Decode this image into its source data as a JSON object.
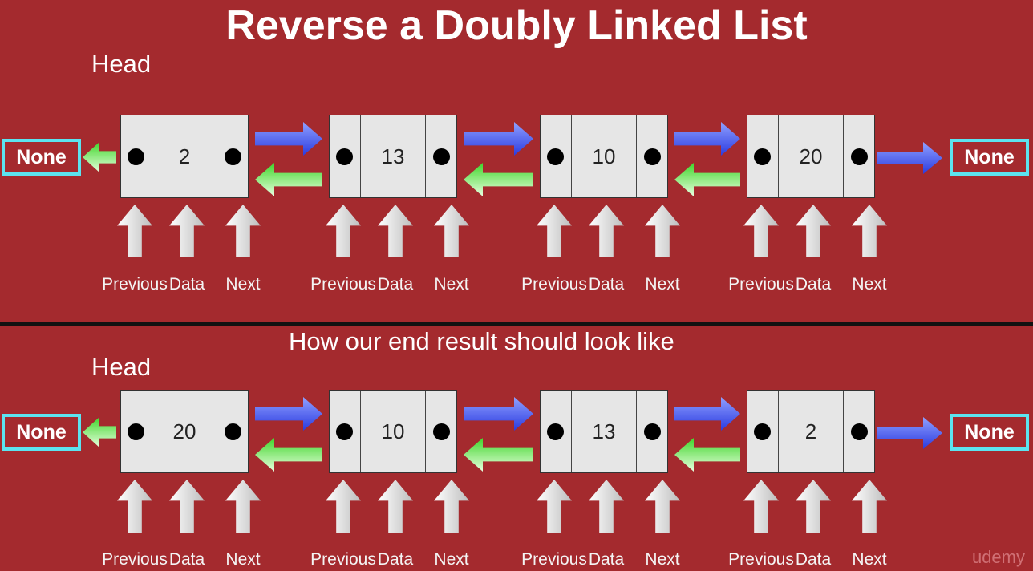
{
  "title": "Reverse a Doubly Linked List",
  "subtitle": "How our end result should look like",
  "watermark": "udemy",
  "colors": {
    "background": "#a42a2e",
    "none_border": "#5ce3ef",
    "next_arrow": "#5b6ef0",
    "prev_arrow": "#5fe04a"
  },
  "field_labels": [
    "Previous",
    "Data",
    "Next"
  ],
  "rows": [
    {
      "head_label": "Head",
      "left_terminal": "None",
      "right_terminal": "None",
      "values": [
        "2",
        "13",
        "10",
        "20"
      ]
    },
    {
      "head_label": "Head",
      "left_terminal": "None",
      "right_terminal": "None",
      "values": [
        "20",
        "10",
        "13",
        "2"
      ]
    }
  ]
}
